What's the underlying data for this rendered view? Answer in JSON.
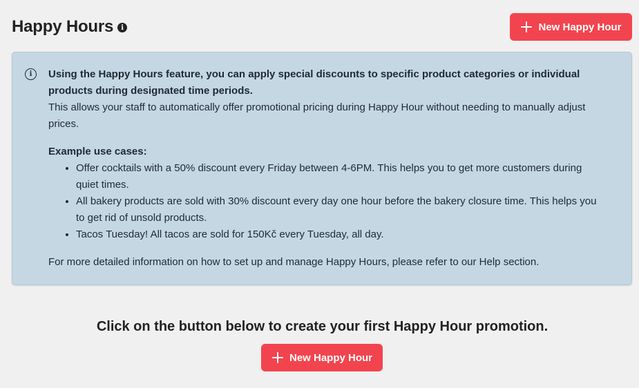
{
  "header": {
    "title": "Happy Hours",
    "info_icon": "info-circle-icon",
    "new_button_label": "New Happy Hour"
  },
  "info_box": {
    "icon": "info-outline-icon",
    "intro_bold": "Using the Happy Hours feature, you can apply special discounts to specific product categories or individual products during designated time periods.",
    "intro_text": "This allows your staff to automatically offer promotional pricing during Happy Hour without needing to manually adjust prices.",
    "examples_heading": "Example use cases:",
    "examples": [
      "Offer cocktails with a 50% discount every Friday between 4-6PM. This helps you to get more customers during quiet times.",
      "All bakery products are sold with 30% discount every day one hour before the bakery closure time. This helps you to get rid of unsold products.",
      "Tacos Tuesday! All tacos are sold for 150Kč every Tuesday, all day."
    ],
    "footer_note": "For more detailed information on how to set up and manage Happy Hours, please refer to our Help section."
  },
  "empty_state": {
    "message": "Click on the button below to create your first Happy Hour promotion.",
    "button_label": "New Happy Hour"
  },
  "colors": {
    "accent": "#f2444e",
    "info_background": "#c5d7e3",
    "page_background": "#f0f0f0"
  }
}
